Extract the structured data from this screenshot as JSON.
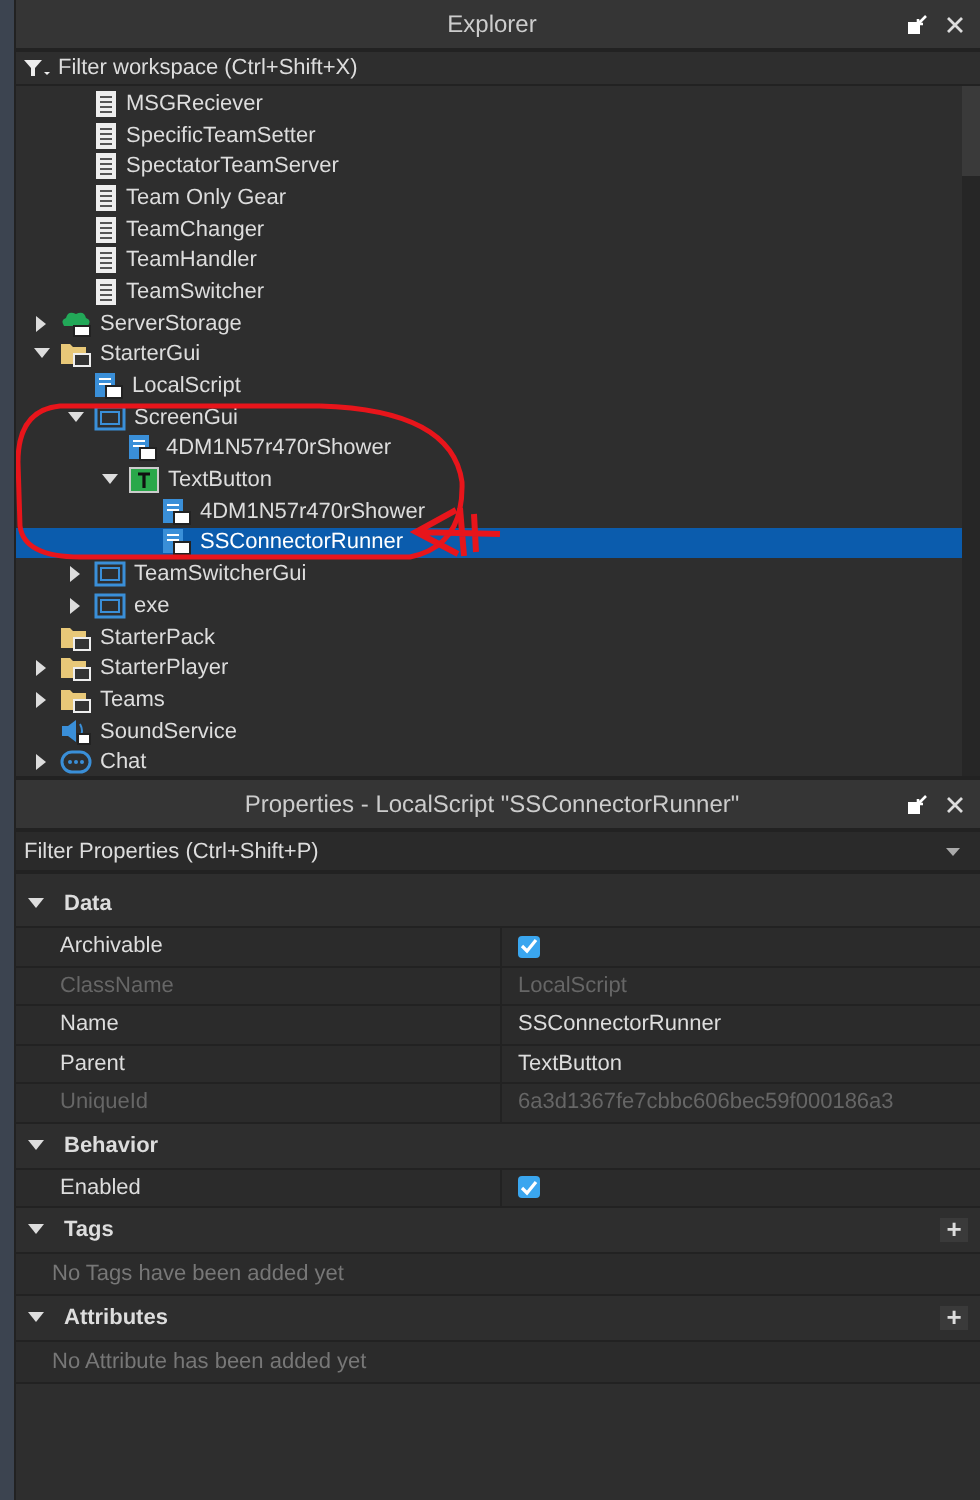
{
  "explorer": {
    "title": "Explorer",
    "filter": {
      "placeholder": "Filter workspace (Ctrl+Shift+X)"
    },
    "scrolled_items": [
      {
        "name": "MSGReciever",
        "kind": "script",
        "selected": false
      },
      {
        "name": "SpecificTeamSetter",
        "kind": "script",
        "selected": false
      },
      {
        "name": "SpectatorTeamServer",
        "kind": "script",
        "selected": false
      },
      {
        "name": "Team Only Gear",
        "kind": "script",
        "selected": false
      },
      {
        "name": "TeamChanger",
        "kind": "script",
        "selected": false
      },
      {
        "name": "TeamHandler",
        "kind": "script",
        "selected": false
      },
      {
        "name": "TeamSwitcher",
        "kind": "script",
        "selected": false
      }
    ],
    "tree": [
      {
        "name": "ServerStorage",
        "kind": "storage",
        "expanded": false,
        "selected": false
      },
      {
        "name": "StarterGui",
        "kind": "folder",
        "expanded": true,
        "selected": false,
        "children": [
          {
            "name": "LocalScript",
            "kind": "localscript",
            "selected": false
          },
          {
            "name": "ScreenGui",
            "kind": "gui",
            "expanded": true,
            "selected": false,
            "children": [
              {
                "name": "4DM1N57r470rShower",
                "kind": "localscript",
                "selected": false
              },
              {
                "name": "TextButton",
                "kind": "textbutton",
                "expanded": true,
                "selected": false,
                "children": [
                  {
                    "name": "4DM1N57r470rShower",
                    "kind": "localscript",
                    "selected": false
                  },
                  {
                    "name": "SSConnectorRunner",
                    "kind": "localscript",
                    "selected": true
                  }
                ]
              }
            ]
          },
          {
            "name": "TeamSwitcherGui",
            "kind": "gui",
            "expanded": false,
            "selected": false
          },
          {
            "name": "exe",
            "kind": "gui",
            "expanded": false,
            "selected": false
          }
        ]
      },
      {
        "name": "StarterPack",
        "kind": "folder",
        "selected": false
      },
      {
        "name": "StarterPlayer",
        "kind": "folder",
        "expanded": false,
        "selected": false
      },
      {
        "name": "Teams",
        "kind": "folder",
        "expanded": false,
        "selected": false
      },
      {
        "name": "SoundService",
        "kind": "sound",
        "selected": false
      },
      {
        "name": "Chat",
        "kind": "chat",
        "expanded": false,
        "selected": false
      }
    ]
  },
  "properties": {
    "title": "Properties - LocalScript \"SSConnectorRunner\"",
    "filter": {
      "placeholder": "Filter Properties (Ctrl+Shift+P)"
    },
    "sections": [
      {
        "name": "Data",
        "expanded": true,
        "rows": [
          {
            "name": "Archivable",
            "kind": "checkbox",
            "checked": true,
            "disabled": false
          },
          {
            "name": "ClassName",
            "kind": "text",
            "value": "LocalScript",
            "disabled": true
          },
          {
            "name": "Name",
            "kind": "text",
            "value": "SSConnectorRunner",
            "disabled": false
          },
          {
            "name": "Parent",
            "kind": "text",
            "value": "TextButton",
            "disabled": false
          },
          {
            "name": "UniqueId",
            "kind": "text",
            "value": "6a3d1367fe7cbbc606bec59f000186a3",
            "disabled": true
          }
        ]
      },
      {
        "name": "Behavior",
        "expanded": true,
        "rows": [
          {
            "name": "Enabled",
            "kind": "checkbox",
            "checked": true,
            "disabled": false
          }
        ]
      },
      {
        "name": "Tags",
        "expanded": true,
        "add": "+",
        "empty": "No Tags have been added yet"
      },
      {
        "name": "Attributes",
        "expanded": true,
        "add": "+",
        "empty": "No Attribute has been added yet"
      }
    ]
  }
}
